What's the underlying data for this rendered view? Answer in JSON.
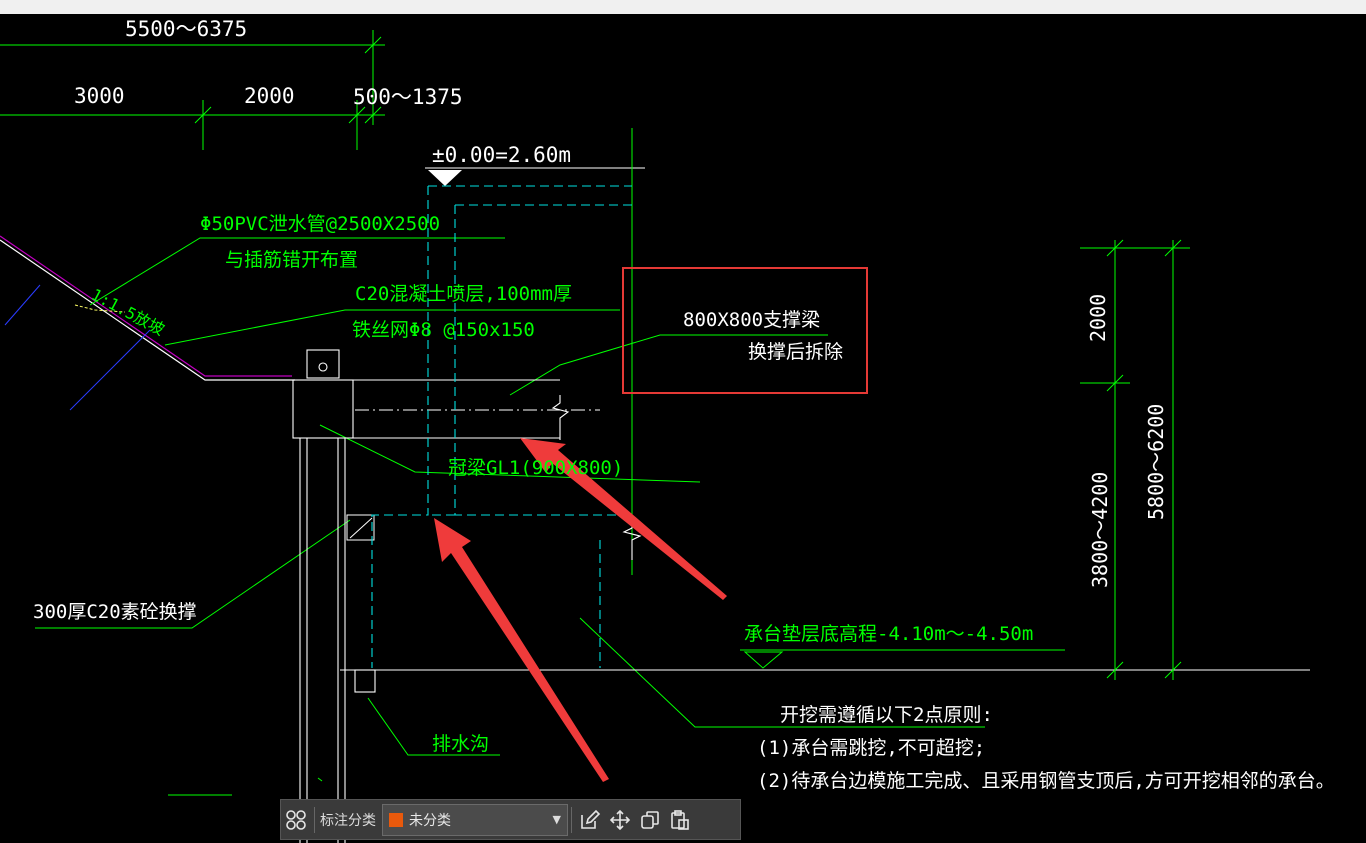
{
  "drawing": {
    "dims_top": {
      "total": "5500～6375",
      "seg1": "3000",
      "seg2": "2000",
      "seg3": "500～1375"
    },
    "elevation": "±0.00=2.60m",
    "pvc_note_1": "Φ50PVC泄水管@2500X2500",
    "pvc_note_2": "与插筋错开布置",
    "slope": "1:1.5放坡",
    "shotcrete_1": "C20混凝土喷层,100mm厚",
    "shotcrete_2": "铁丝网Φ8 @150x150",
    "beam_1": "800X800支撑梁",
    "beam_2": "换撑后拆除",
    "crown_beam": "冠梁GL1(900X800)",
    "concrete": "300厚C20素砼换撑",
    "cushion": "承台垫层底高程-4.10m～-4.50m",
    "drain": "排水沟",
    "dims_right": {
      "upper": "2000",
      "lower": "3800～4200",
      "total": "5800～6200"
    },
    "principles_title": "开挖需遵循以下2点原则:",
    "principle_1": "(1)承台需跳挖,不可超挖;",
    "principle_2": "(2)待承台边模施工完成、且采用钢管支顶后,方可开挖相邻的承台。"
  },
  "toolbar": {
    "label": "标注分类",
    "select_value": "未分类",
    "swatch_color": "#e8590c",
    "icons": [
      "grid-icon",
      "edit-icon",
      "move-icon",
      "copy-icon",
      "paste-icon"
    ]
  },
  "colors": {
    "cad_green": "#00ff00",
    "cad_white": "#ffffff",
    "cad_cyan": "#00e0e0",
    "cad_magenta": "#c000c0",
    "highlight_red": "#e53935",
    "arrow_red": "#ef3b3b"
  }
}
